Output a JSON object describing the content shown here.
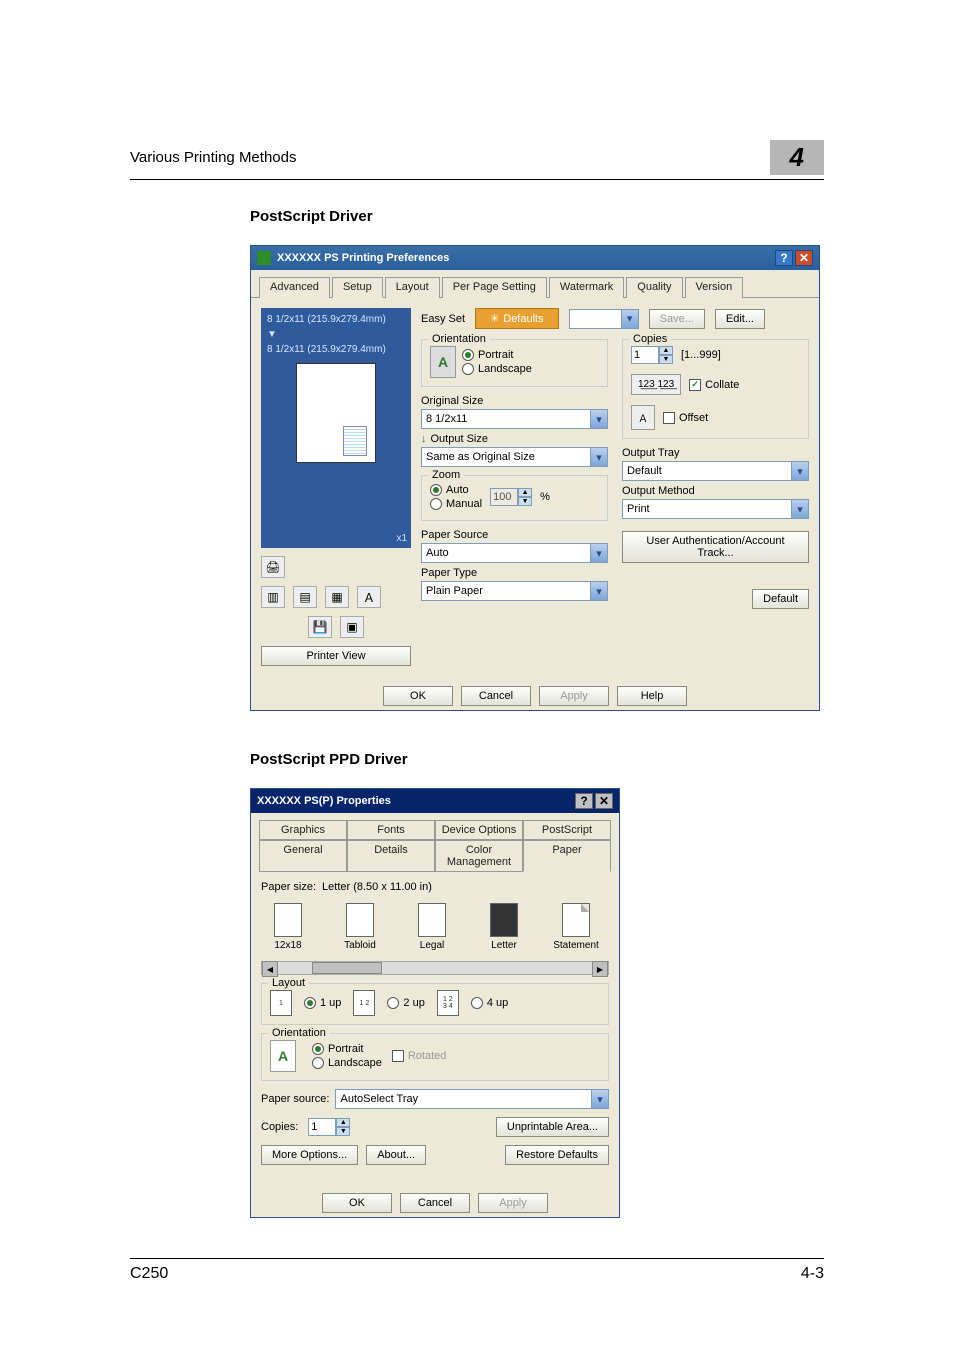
{
  "page": {
    "header_title": "Various Printing Methods",
    "chapter_number": "4",
    "footer_left": "C250",
    "footer_right": "4-3"
  },
  "sections": {
    "ps_driver": "PostScript Driver",
    "ppd_driver": "PostScript PPD Driver"
  },
  "win1": {
    "title": "XXXXXX PS Printing Preferences",
    "tabs": [
      "Advanced",
      "Setup",
      "Layout",
      "Per Page Setting",
      "Watermark",
      "Quality",
      "Version"
    ],
    "active_tab": 1,
    "preview": {
      "dim1": "8 1/2x11 (215.9x279.4mm)",
      "dim2": "8 1/2x11 (215.9x279.4mm)",
      "zoom_tag": "x1",
      "printer_view": "Printer View"
    },
    "easy_set": {
      "label": "Easy Set",
      "defaults_button": "Defaults",
      "save": "Save...",
      "edit": "Edit..."
    },
    "orientation": {
      "legend": "Orientation",
      "portrait": "Portrait",
      "landscape": "Landscape",
      "selected": "portrait"
    },
    "original_size": {
      "label": "Original Size",
      "value": "8 1/2x11"
    },
    "output_size": {
      "label": "Output Size",
      "value": "Same as Original Size"
    },
    "zoom": {
      "legend": "Zoom",
      "auto": "Auto",
      "manual": "Manual",
      "value": "100",
      "unit": "%",
      "selected": "auto"
    },
    "paper_source": {
      "label": "Paper Source",
      "value": "Auto"
    },
    "paper_type": {
      "label": "Paper Type",
      "value": "Plain Paper"
    },
    "copies": {
      "legend": "Copies",
      "value": "1",
      "range": "[1...999]",
      "collate": "Collate",
      "collate_checked": true,
      "offset": "Offset",
      "offset_checked": false
    },
    "output_tray": {
      "label": "Output Tray",
      "value": "Default"
    },
    "output_method": {
      "label": "Output Method",
      "value": "Print"
    },
    "user_auth_button": "User Authentication/Account Track...",
    "default_button": "Default",
    "footer": {
      "ok": "OK",
      "cancel": "Cancel",
      "apply": "Apply",
      "help": "Help"
    }
  },
  "win2": {
    "title": "XXXXXX PS(P) Properties",
    "tabs_row1": [
      "General",
      "Details",
      "Color Management",
      "Paper"
    ],
    "tabs_row2": [
      "Graphics",
      "Fonts",
      "Device Options",
      "PostScript"
    ],
    "active_tab": "Paper",
    "paper_size_label": "Paper size:",
    "paper_size_value": "Letter (8.50 x 11.00 in)",
    "paper_icons": [
      "12x18",
      "Tabloid",
      "Legal",
      "Letter",
      "Statement"
    ],
    "layout": {
      "legend": "Layout",
      "one_up": "1 up",
      "two_up": "2 up",
      "four_up": "4 up",
      "selected": "1"
    },
    "orientation": {
      "legend": "Orientation",
      "portrait": "Portrait",
      "landscape": "Landscape",
      "rotated": "Rotated",
      "selected": "portrait"
    },
    "paper_source": {
      "label": "Paper source:",
      "value": "AutoSelect Tray"
    },
    "copies": {
      "label": "Copies:",
      "value": "1"
    },
    "buttons": {
      "unprintable": "Unprintable Area...",
      "more_options": "More Options...",
      "about": "About...",
      "restore": "Restore Defaults"
    },
    "footer": {
      "ok": "OK",
      "cancel": "Cancel",
      "apply": "Apply"
    }
  }
}
